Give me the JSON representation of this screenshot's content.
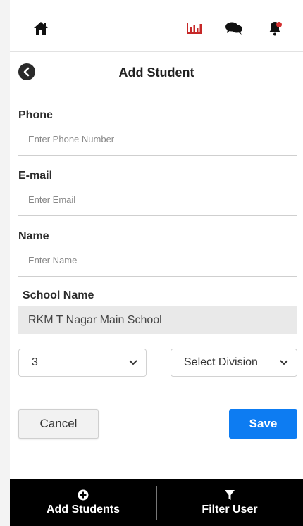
{
  "page": {
    "title": "Add Student"
  },
  "topbar": {
    "icons": [
      "home-icon",
      "bar-chart-icon",
      "chat-icon",
      "bell-icon"
    ],
    "accent_color": "#c62828"
  },
  "form": {
    "phone": {
      "label": "Phone",
      "placeholder": "Enter Phone Number",
      "value": ""
    },
    "email": {
      "label": "E-mail",
      "placeholder": "Enter Email",
      "value": ""
    },
    "name": {
      "label": "Name",
      "placeholder": "Enter Name",
      "value": ""
    },
    "school": {
      "label": "School Name",
      "value": "RKM T Nagar Main School"
    },
    "grade": {
      "selected": "3"
    },
    "division": {
      "selected": "Select Division"
    }
  },
  "actions": {
    "cancel_label": "Cancel",
    "save_label": "Save",
    "save_color": "#0d7cf2"
  },
  "bottom_nav": {
    "add_students": {
      "label": "Add Students",
      "icon": "plus-circle-icon"
    },
    "filter_user": {
      "label": "Filter User",
      "icon": "filter-icon"
    }
  }
}
